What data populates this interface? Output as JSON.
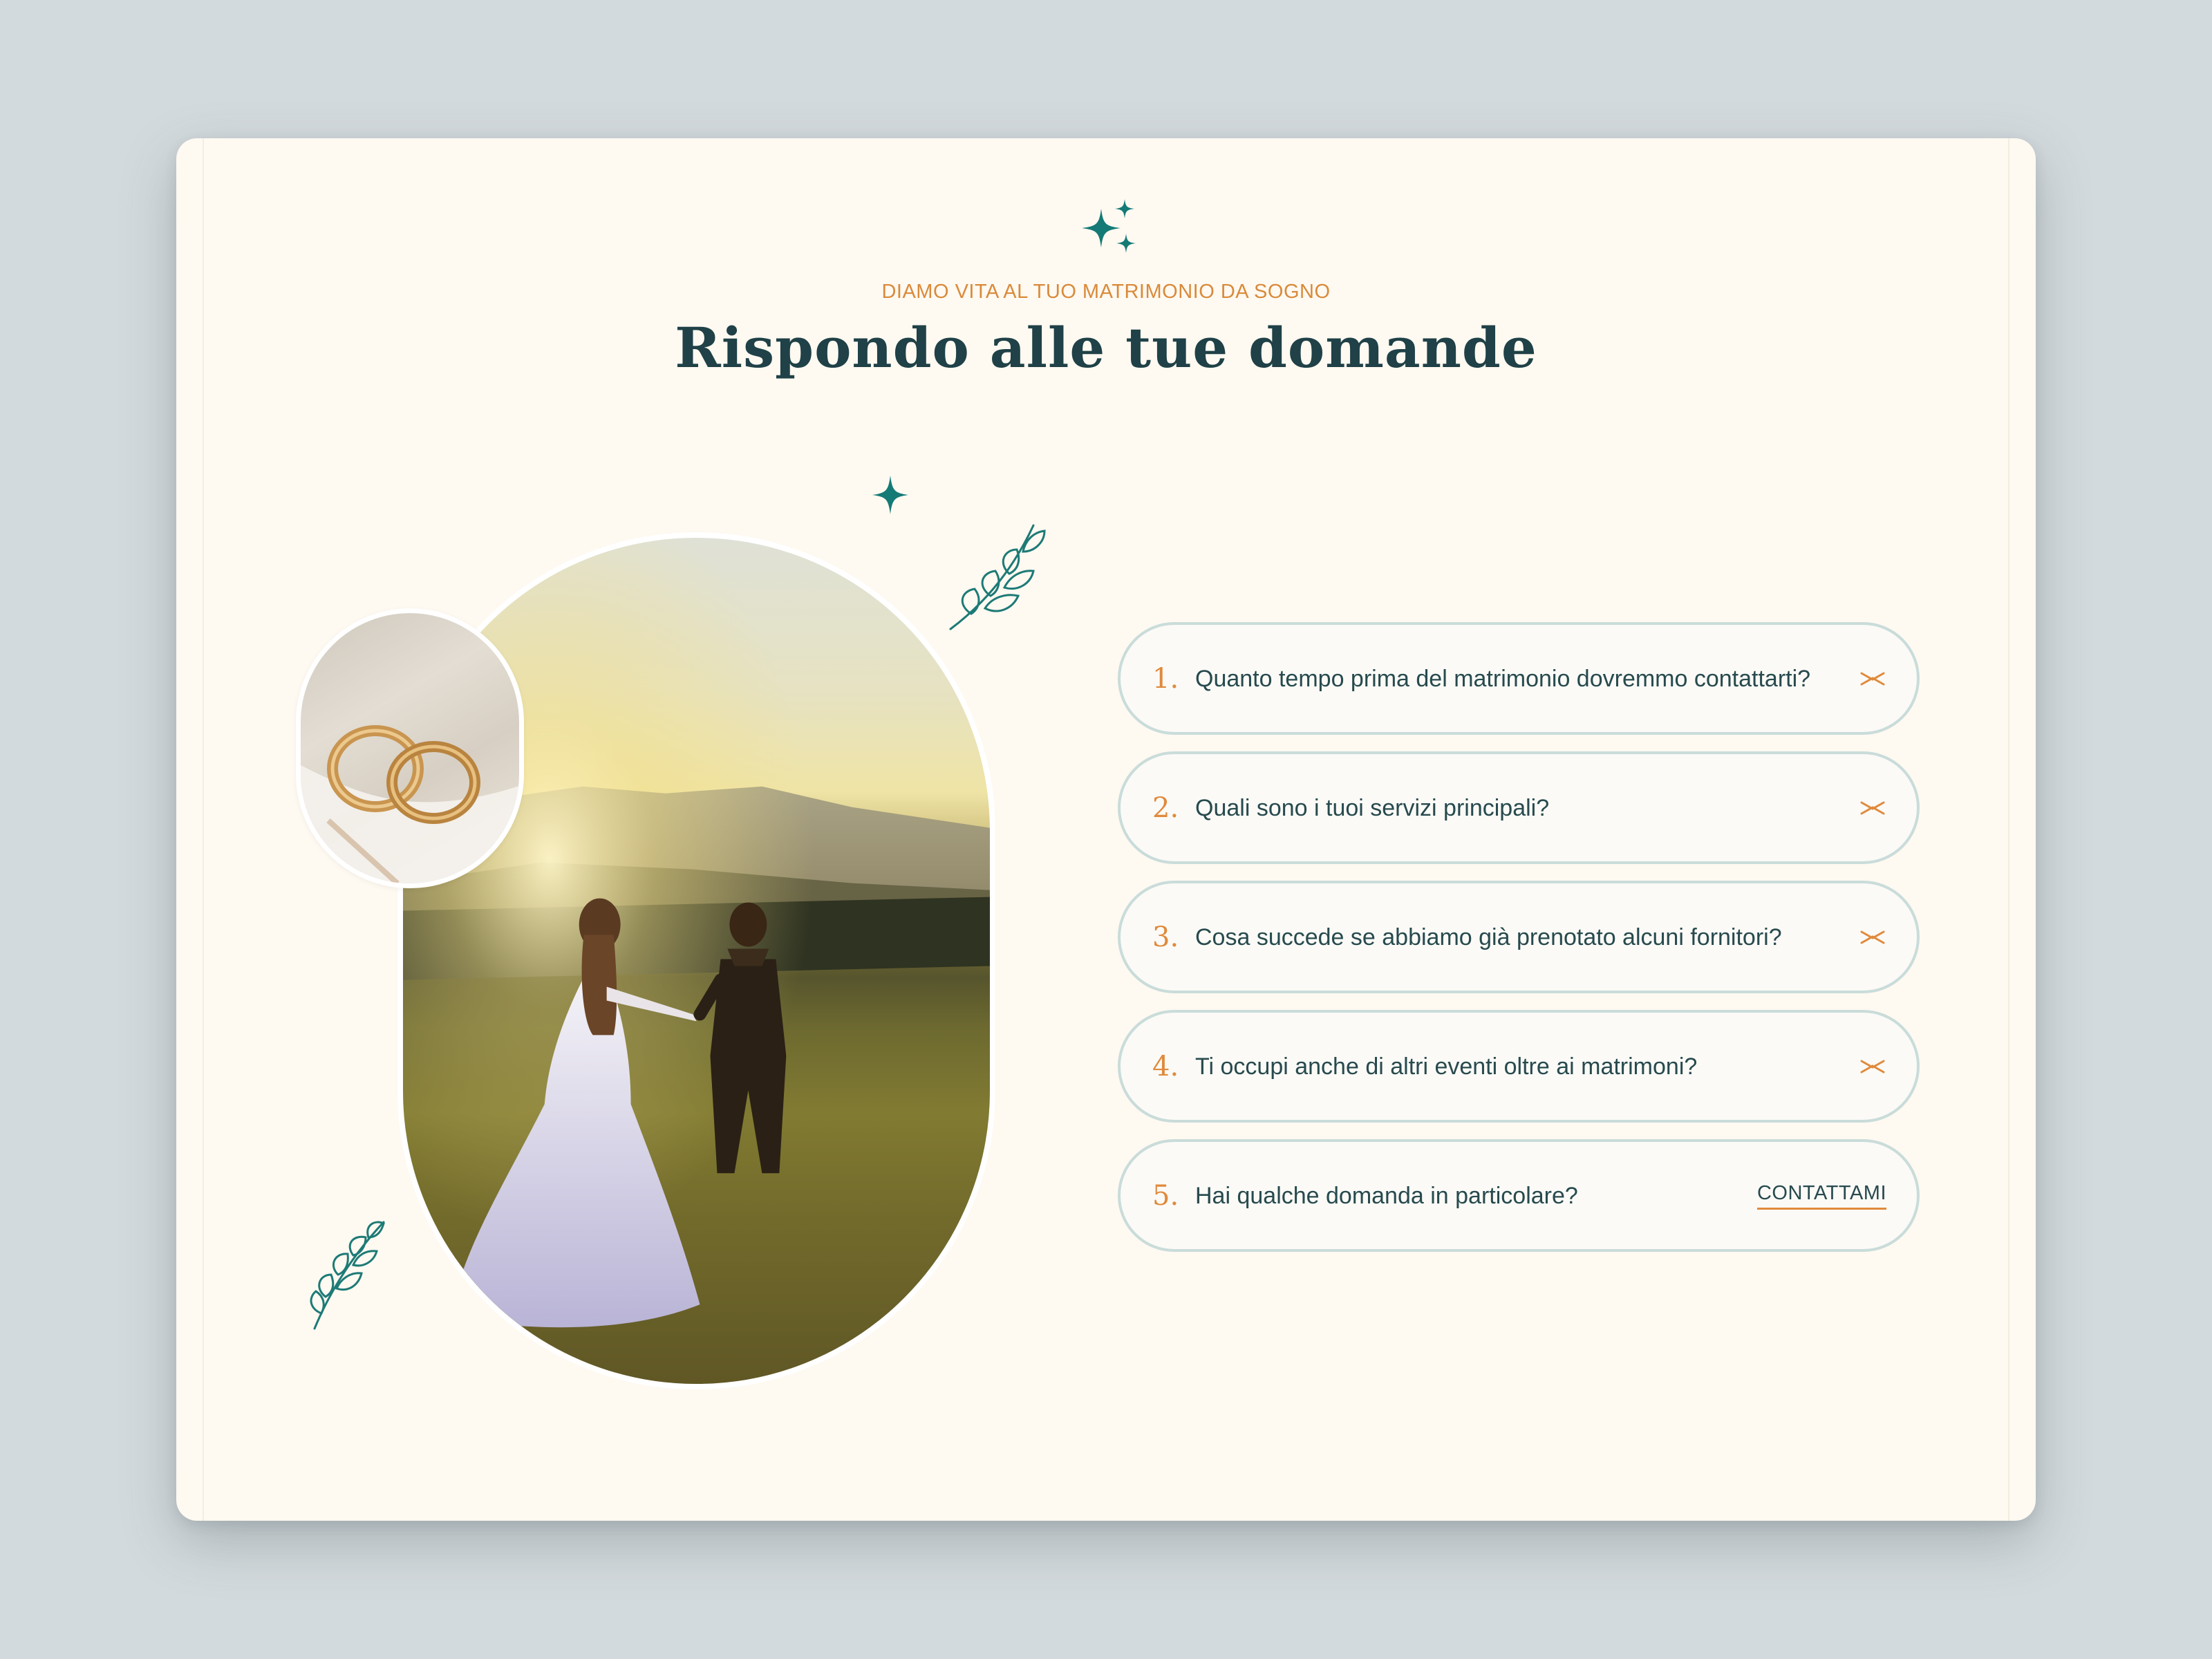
{
  "header": {
    "eyebrow": "DIAMO VITA AL TUO MATRIMONIO DA SOGNO",
    "title": "Rispondo alle tue domande"
  },
  "faq": {
    "items": [
      {
        "number": "1.",
        "question": "Quanto tempo prima del matrimonio dovremmo contattarti?"
      },
      {
        "number": "2.",
        "question": "Quali sono i tuoi servizi principali?"
      },
      {
        "number": "3.",
        "question": "Cosa succede se abbiamo già prenotato alcuni fornitori?"
      },
      {
        "number": "4.",
        "question": "Ti occupi anche di altri eventi oltre ai matrimoni?"
      },
      {
        "number": "5.",
        "question": "Hai qualche domanda in particolare?"
      }
    ],
    "cta_label": "CONTATTAMI"
  },
  "icons": {
    "header": "sparkles-icon",
    "decor": [
      "sparkle-icon",
      "leaf-branch-icon"
    ],
    "toggle": "chevron-toggle-icon"
  },
  "colors": {
    "accent": "#e08a3c",
    "teal": "#147a76",
    "heading": "#1f4147",
    "background": "#fef9f1",
    "border": "#c9dcda"
  }
}
